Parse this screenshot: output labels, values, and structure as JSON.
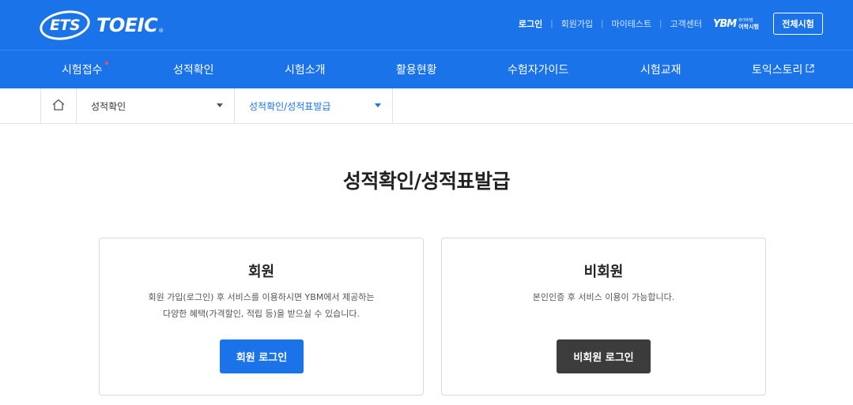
{
  "header": {
    "logo": {
      "ets": "ETS",
      "brand": "TOEIC",
      "reg": "®"
    },
    "util": [
      {
        "label": "로그인",
        "strong": true
      },
      {
        "label": "회원가입"
      },
      {
        "label": "마이테스트"
      },
      {
        "label": "고객센터"
      }
    ],
    "ybm": {
      "mark": "YBM",
      "sub1": "와이비엠",
      "sub2": "어학시험"
    },
    "all_exams": "전체시험"
  },
  "gnb": {
    "items": [
      {
        "label": "시험접수",
        "badge": true
      },
      {
        "label": "성적확인"
      },
      {
        "label": "시험소개"
      },
      {
        "label": "활용현황"
      },
      {
        "label": "수험자가이드"
      },
      {
        "label": "시험교재"
      },
      {
        "label": "토익스토리",
        "external": true
      }
    ]
  },
  "breadcrumb": {
    "home_icon": "home-icon",
    "select1": "성적확인",
    "select2": "성적확인/성적표발급"
  },
  "page": {
    "title": "성적확인/성적표발급"
  },
  "cards": {
    "member": {
      "title": "회원",
      "desc_line1": "회원 가입(로그인) 후 서비스를 이용하시면 YBM에서 제공하는",
      "desc_line2": "다양한 혜택(가격할인, 적립 등)을 받으실 수 있습니다.",
      "button": "회원 로그인"
    },
    "guest": {
      "title": "비회원",
      "desc_line1": "본인인증 후 서비스 이용이 가능합니다.",
      "button": "비회원 로그인"
    }
  },
  "colors": {
    "primary": "#1a73e8",
    "dark_button": "#3c3c3c",
    "badge": "#ff4d4d"
  }
}
